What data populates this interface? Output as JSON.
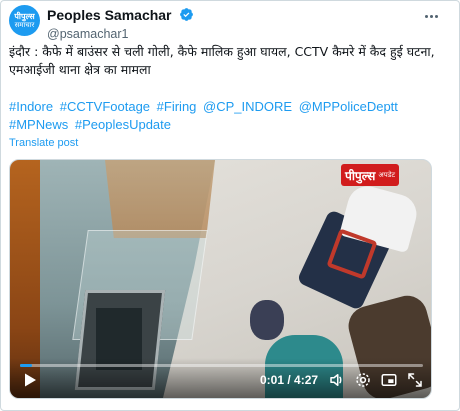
{
  "author": {
    "display_name": "Peoples Samachar",
    "handle": "@psamachar1",
    "avatar_line1": "पीपुल्स",
    "avatar_line2": "समाचार"
  },
  "tweet": {
    "text": "इंदौर : कैफे में बाउंसर से चली गोली, कैफे मालिक हुआ घायल, CCTV कैमरे में कैद हुई घटना, एमआईजी थाना क्षेत्र का मामला",
    "hashtags": [
      "#Indore",
      "#CCTVFootage",
      "#Firing",
      "@CP_INDORE",
      "@MPPoliceDeptt",
      "#MPNews",
      "#PeoplesUpdate"
    ],
    "translate_label": "Translate post"
  },
  "video": {
    "watermark_main": "पीपुल्स",
    "watermark_sub": "अपडेट",
    "time_display": "0:01 / 4:27",
    "progress_fraction": 0.004
  },
  "colors": {
    "accent": "#1d9bf0",
    "text": "#0f1419",
    "secondary": "#536471",
    "watermark": "#d11c1c"
  },
  "icons": [
    "verified-badge-icon",
    "more-icon",
    "play-icon",
    "volume-icon",
    "settings-icon",
    "fullscreen-icon",
    "expand-icon"
  ]
}
